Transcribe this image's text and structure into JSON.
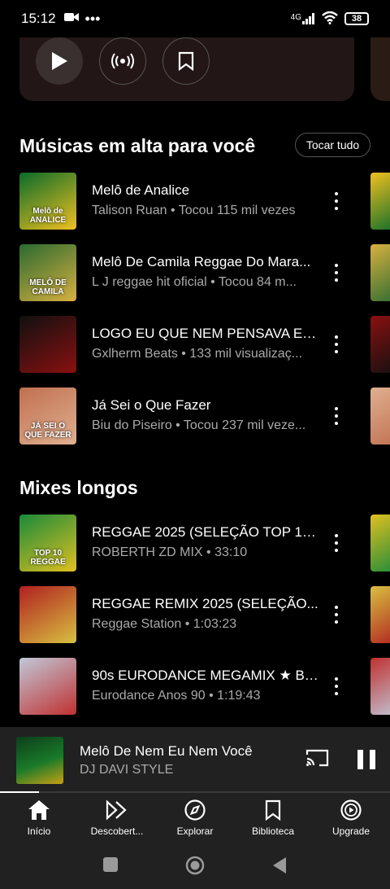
{
  "status_bar": {
    "time": "15:12",
    "network": "4G",
    "battery": "38"
  },
  "top_card": {
    "buttons": [
      "play",
      "radio",
      "save"
    ]
  },
  "section1": {
    "title": "Músicas em alta para você",
    "play_all_label": "Tocar tudo",
    "items": [
      {
        "title": "Melô de Analice",
        "subtitle": "Talison Ruan • Tocou 115 mil vezes",
        "thumb_colors": [
          "#0a6b2a",
          "#f0c020"
        ],
        "thumb_text": "Melô de ANALICE"
      },
      {
        "title": "Melô De Camila Reggae Do Mara...",
        "subtitle": "L J reggae hit oficial • Tocou 84 m...",
        "thumb_colors": [
          "#2a6a30",
          "#d8b040"
        ],
        "thumb_text": "MELÔ DE CAMILA"
      },
      {
        "title": "LOGO EU QUE NEM PENSAVA EU...",
        "subtitle": "Gxlherm Beats • 133 mil visualizaç...",
        "thumb_colors": [
          "#101010",
          "#8a1010"
        ],
        "thumb_text": ""
      },
      {
        "title": "Já Sei o Que Fazer",
        "subtitle": "Biu do Piseiro • Tocou 237 mil veze...",
        "thumb_colors": [
          "#c07050",
          "#e0b090"
        ],
        "thumb_text": "JÁ SEI O QUE FAZER"
      }
    ]
  },
  "section2": {
    "title": "Mixes longos",
    "items": [
      {
        "title": "REGGAE 2025 (SELEÇÃO TOP 10)...",
        "subtitle": "ROBERTH ZD MIX • 33:10",
        "thumb_colors": [
          "#1a8a3a",
          "#e0c020"
        ],
        "thumb_text": "TOP 10 REGGAE"
      },
      {
        "title": "REGGAE REMIX 2025 (SELEÇÃO...",
        "subtitle": "Reggae Station • 1:03:23",
        "thumb_colors": [
          "#b02020",
          "#d8c040"
        ],
        "thumb_text": ""
      },
      {
        "title": "90s EURODANCE MEGAMIX ★ Be...",
        "subtitle": "Eurodance Anos 90 • 1:19:43",
        "thumb_colors": [
          "#c0c8d8",
          "#c03030"
        ],
        "thumb_text": ""
      }
    ]
  },
  "mini_player": {
    "title": "Melô De Nem Eu Nem Você",
    "artist": "DJ DAVI STYLE",
    "progress": 0.1
  },
  "bottom_nav": [
    {
      "label": "Início",
      "icon": "home-icon",
      "active": true
    },
    {
      "label": "Descobert...",
      "icon": "discover-icon"
    },
    {
      "label": "Explorar",
      "icon": "compass-icon"
    },
    {
      "label": "Biblioteca",
      "icon": "library-icon"
    },
    {
      "label": "Upgrade",
      "icon": "upgrade-icon"
    }
  ]
}
